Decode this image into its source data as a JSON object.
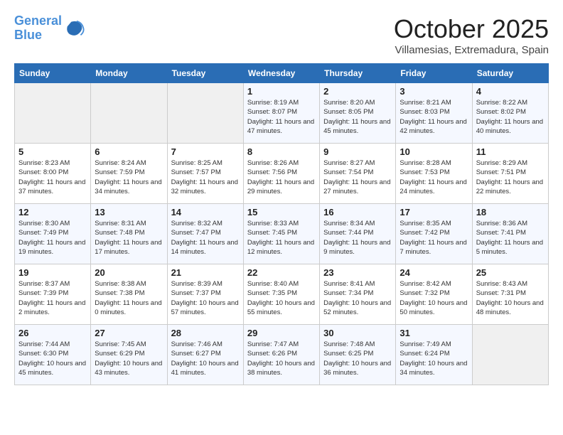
{
  "header": {
    "logo_line1": "General",
    "logo_line2": "Blue",
    "month": "October 2025",
    "location": "Villamesias, Extremadura, Spain"
  },
  "days_of_week": [
    "Sunday",
    "Monday",
    "Tuesday",
    "Wednesday",
    "Thursday",
    "Friday",
    "Saturday"
  ],
  "weeks": [
    [
      {
        "num": "",
        "info": ""
      },
      {
        "num": "",
        "info": ""
      },
      {
        "num": "",
        "info": ""
      },
      {
        "num": "1",
        "info": "Sunrise: 8:19 AM\nSunset: 8:07 PM\nDaylight: 11 hours and 47 minutes."
      },
      {
        "num": "2",
        "info": "Sunrise: 8:20 AM\nSunset: 8:05 PM\nDaylight: 11 hours and 45 minutes."
      },
      {
        "num": "3",
        "info": "Sunrise: 8:21 AM\nSunset: 8:03 PM\nDaylight: 11 hours and 42 minutes."
      },
      {
        "num": "4",
        "info": "Sunrise: 8:22 AM\nSunset: 8:02 PM\nDaylight: 11 hours and 40 minutes."
      }
    ],
    [
      {
        "num": "5",
        "info": "Sunrise: 8:23 AM\nSunset: 8:00 PM\nDaylight: 11 hours and 37 minutes."
      },
      {
        "num": "6",
        "info": "Sunrise: 8:24 AM\nSunset: 7:59 PM\nDaylight: 11 hours and 34 minutes."
      },
      {
        "num": "7",
        "info": "Sunrise: 8:25 AM\nSunset: 7:57 PM\nDaylight: 11 hours and 32 minutes."
      },
      {
        "num": "8",
        "info": "Sunrise: 8:26 AM\nSunset: 7:56 PM\nDaylight: 11 hours and 29 minutes."
      },
      {
        "num": "9",
        "info": "Sunrise: 8:27 AM\nSunset: 7:54 PM\nDaylight: 11 hours and 27 minutes."
      },
      {
        "num": "10",
        "info": "Sunrise: 8:28 AM\nSunset: 7:53 PM\nDaylight: 11 hours and 24 minutes."
      },
      {
        "num": "11",
        "info": "Sunrise: 8:29 AM\nSunset: 7:51 PM\nDaylight: 11 hours and 22 minutes."
      }
    ],
    [
      {
        "num": "12",
        "info": "Sunrise: 8:30 AM\nSunset: 7:49 PM\nDaylight: 11 hours and 19 minutes."
      },
      {
        "num": "13",
        "info": "Sunrise: 8:31 AM\nSunset: 7:48 PM\nDaylight: 11 hours and 17 minutes."
      },
      {
        "num": "14",
        "info": "Sunrise: 8:32 AM\nSunset: 7:47 PM\nDaylight: 11 hours and 14 minutes."
      },
      {
        "num": "15",
        "info": "Sunrise: 8:33 AM\nSunset: 7:45 PM\nDaylight: 11 hours and 12 minutes."
      },
      {
        "num": "16",
        "info": "Sunrise: 8:34 AM\nSunset: 7:44 PM\nDaylight: 11 hours and 9 minutes."
      },
      {
        "num": "17",
        "info": "Sunrise: 8:35 AM\nSunset: 7:42 PM\nDaylight: 11 hours and 7 minutes."
      },
      {
        "num": "18",
        "info": "Sunrise: 8:36 AM\nSunset: 7:41 PM\nDaylight: 11 hours and 5 minutes."
      }
    ],
    [
      {
        "num": "19",
        "info": "Sunrise: 8:37 AM\nSunset: 7:39 PM\nDaylight: 11 hours and 2 minutes."
      },
      {
        "num": "20",
        "info": "Sunrise: 8:38 AM\nSunset: 7:38 PM\nDaylight: 11 hours and 0 minutes."
      },
      {
        "num": "21",
        "info": "Sunrise: 8:39 AM\nSunset: 7:37 PM\nDaylight: 10 hours and 57 minutes."
      },
      {
        "num": "22",
        "info": "Sunrise: 8:40 AM\nSunset: 7:35 PM\nDaylight: 10 hours and 55 minutes."
      },
      {
        "num": "23",
        "info": "Sunrise: 8:41 AM\nSunset: 7:34 PM\nDaylight: 10 hours and 52 minutes."
      },
      {
        "num": "24",
        "info": "Sunrise: 8:42 AM\nSunset: 7:32 PM\nDaylight: 10 hours and 50 minutes."
      },
      {
        "num": "25",
        "info": "Sunrise: 8:43 AM\nSunset: 7:31 PM\nDaylight: 10 hours and 48 minutes."
      }
    ],
    [
      {
        "num": "26",
        "info": "Sunrise: 7:44 AM\nSunset: 6:30 PM\nDaylight: 10 hours and 45 minutes."
      },
      {
        "num": "27",
        "info": "Sunrise: 7:45 AM\nSunset: 6:29 PM\nDaylight: 10 hours and 43 minutes."
      },
      {
        "num": "28",
        "info": "Sunrise: 7:46 AM\nSunset: 6:27 PM\nDaylight: 10 hours and 41 minutes."
      },
      {
        "num": "29",
        "info": "Sunrise: 7:47 AM\nSunset: 6:26 PM\nDaylight: 10 hours and 38 minutes."
      },
      {
        "num": "30",
        "info": "Sunrise: 7:48 AM\nSunset: 6:25 PM\nDaylight: 10 hours and 36 minutes."
      },
      {
        "num": "31",
        "info": "Sunrise: 7:49 AM\nSunset: 6:24 PM\nDaylight: 10 hours and 34 minutes."
      },
      {
        "num": "",
        "info": ""
      }
    ]
  ]
}
